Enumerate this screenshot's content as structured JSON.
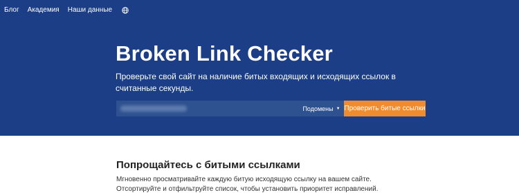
{
  "nav": {
    "items": [
      "Блог",
      "Академия",
      "Наши данные"
    ],
    "globe_icon": "globe-icon"
  },
  "hero": {
    "title": "Broken Link Checker",
    "subtitle": "Проверьте свой сайт на наличие битых входящих и исходящих ссылок в считанные секунды."
  },
  "search": {
    "value": "",
    "domains_label": "Подомены",
    "check_button": "Проверить битые ссылки"
  },
  "section": {
    "title": "Попрощайтесь с битыми ссылками",
    "text": "Мгновенно просматривайте каждую битую исходящую ссылку на вашем сайте. Отсортируйте и отфильтруйте список, чтобы установить приоритет исправлений."
  },
  "colors": {
    "hero_bg": "#1c3e86",
    "input_bg": "#2e518f",
    "accent": "#f08c2d"
  }
}
